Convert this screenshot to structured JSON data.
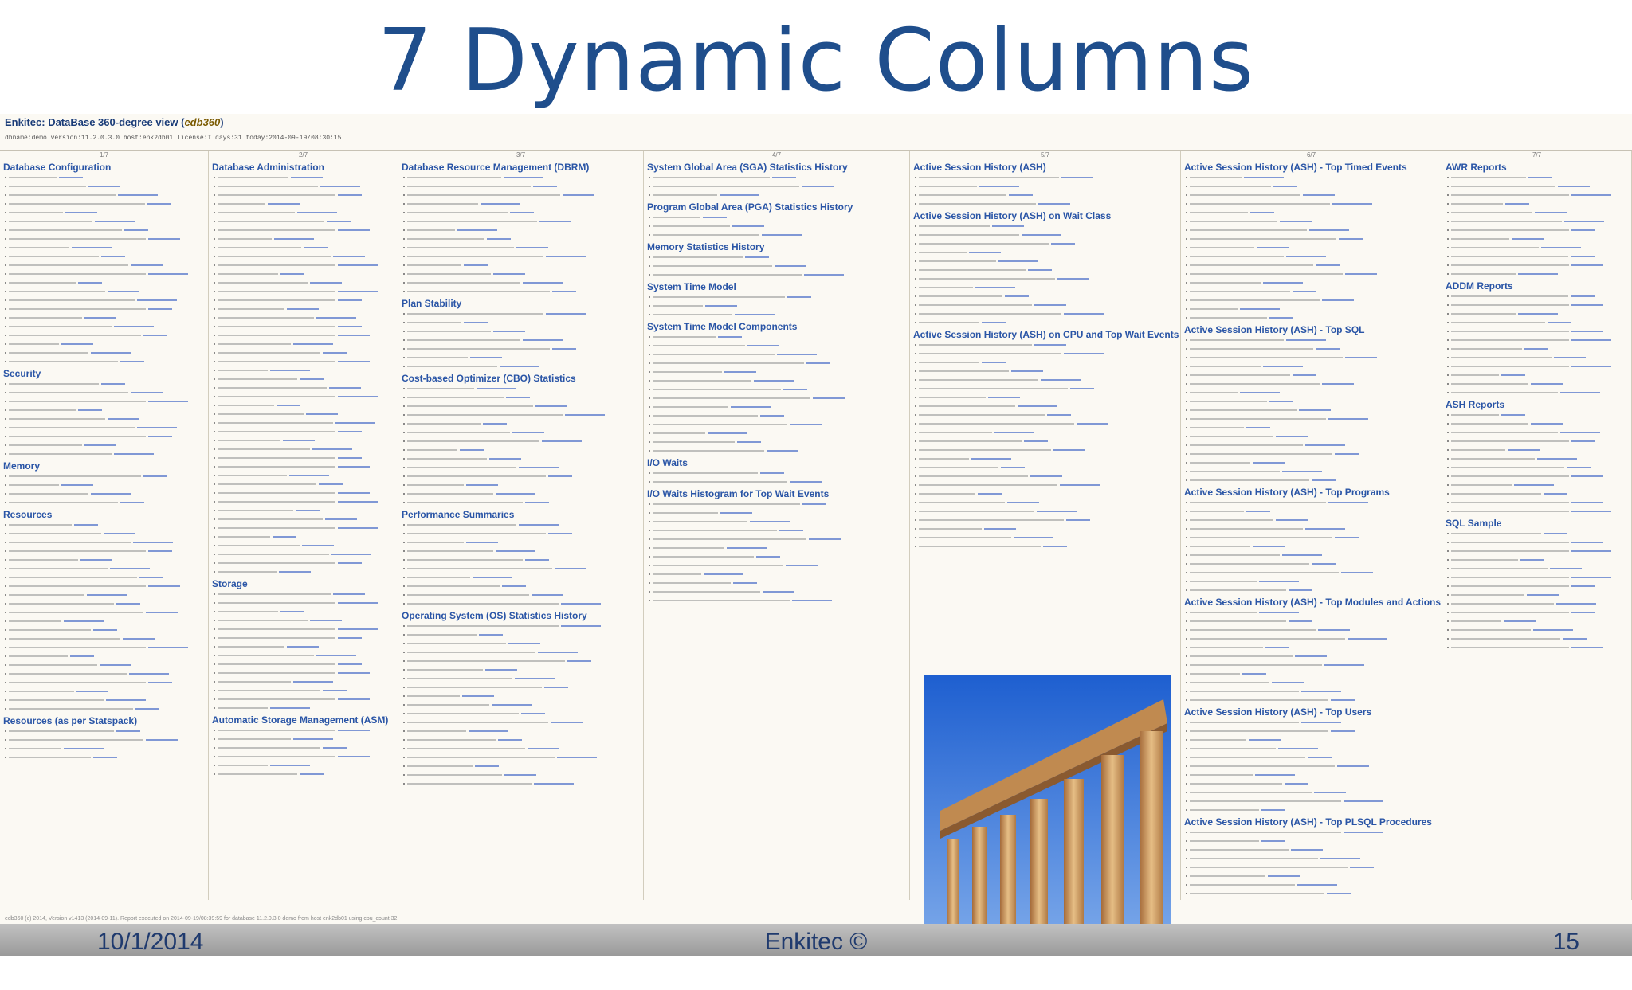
{
  "slide": {
    "title": "7 Dynamic Columns",
    "footer": {
      "date": "10/1/2014",
      "center": "Enkitec ©",
      "page": "15"
    }
  },
  "screenshot": {
    "header_prefix": "Enkitec",
    "header_title": ": DataBase 360-degree view (",
    "header_accent": "edb360",
    "header_suffix": ")",
    "meta_line": "dbname:demo version:11.2.0.3.0 host:enk2db01 license:T days:31 today:2014-09-19/08:30:15",
    "footer_note": "edb360 (c) 2014, Version v1413 (2014-09-11). Report executed on 2014-09-19/08:39:59 for database 11.2.0.3.0 demo from host enk2db01 using cpu_count 32",
    "column_indexes": [
      "1/7",
      "2/7",
      "3/7",
      "4/7",
      "5/7",
      "6/7",
      "7/7"
    ],
    "columns": [
      {
        "sections": [
          {
            "title": "Database Configuration",
            "items": 22
          },
          {
            "title": "Security",
            "items": 9
          },
          {
            "title": "Memory",
            "items": 4
          },
          {
            "title": "Resources",
            "items": 22
          },
          {
            "title": "Resources (as per Statspack)",
            "items": 4
          }
        ]
      },
      {
        "sections": [
          {
            "title": "Database Administration",
            "items": 46
          },
          {
            "title": "Storage",
            "items": 14
          },
          {
            "title": "Automatic Storage Management (ASM)",
            "items": 6
          }
        ]
      },
      {
        "sections": [
          {
            "title": "Database Resource Management (DBRM)",
            "items": 14
          },
          {
            "title": "Plan Stability",
            "items": 7
          },
          {
            "title": "Cost-based Optimizer (CBO) Statistics",
            "items": 14
          },
          {
            "title": "Performance Summaries",
            "items": 10
          },
          {
            "title": "Operating System (OS) Statistics History",
            "items": 19
          }
        ]
      },
      {
        "sections": [
          {
            "title": "System Global Area (SGA) Statistics History",
            "items": 3
          },
          {
            "title": "Program Global Area (PGA) Statistics History",
            "items": 3
          },
          {
            "title": "Memory Statistics History",
            "items": 3
          },
          {
            "title": "System Time Model",
            "items": 3
          },
          {
            "title": "System Time Model Components",
            "items": 14
          },
          {
            "title": "I/O Waits",
            "items": 2
          },
          {
            "title": "I/O Waits Histogram for Top Wait Events",
            "items": 12
          }
        ]
      },
      {
        "sections": [
          {
            "title": "Active Session History (ASH)",
            "items": 4
          },
          {
            "title": "Active Session History (ASH) on Wait Class",
            "items": 12
          },
          {
            "title": "Active Session History (ASH) on CPU and Top Wait Events",
            "items": 24
          }
        ]
      },
      {
        "sections": [
          {
            "title": "Active Session History (ASH) - Top Timed Events",
            "items": 17
          },
          {
            "title": "Active Session History (ASH) - Top SQL",
            "items": 17
          },
          {
            "title": "Active Session History (ASH) - Top Programs",
            "items": 11
          },
          {
            "title": "Active Session History (ASH) - Top Modules and Actions",
            "items": 11
          },
          {
            "title": "Active Session History (ASH) - Top Users",
            "items": 11
          },
          {
            "title": "Active Session History (ASH) - Top PLSQL Procedures",
            "items": 11
          }
        ]
      },
      {
        "sections": [
          {
            "title": "AWR Reports",
            "items": 12
          },
          {
            "title": "ADDM Reports",
            "items": 12
          },
          {
            "title": "ASH Reports",
            "items": 12
          },
          {
            "title": "SQL Sample",
            "items": 14
          }
        ]
      }
    ],
    "photo_alt": "ancient colonnade ruins"
  },
  "colors": {
    "title": "#1f4e8c",
    "section": "#2a55a6",
    "footer": "#1f3a6e"
  }
}
